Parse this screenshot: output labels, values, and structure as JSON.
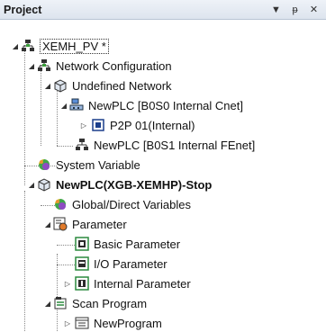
{
  "panel": {
    "title": "Project",
    "controls": {
      "dropdown": "▼",
      "pin": "ᵽ",
      "close": "✕"
    }
  },
  "tree": {
    "root": "XEMH_PV *",
    "network_config": "Network Configuration",
    "undefined_network": "Undefined Network",
    "plc_cnet": "NewPLC [B0S0 Internal Cnet]",
    "p2p": "P2P 01(Internal)",
    "plc_fenet": "NewPLC [B0S1 Internal FEnet]",
    "system_variable": "System Variable",
    "plc_main": "NewPLC(XGB-XEMHP)-Stop",
    "global_vars": "Global/Direct Variables",
    "parameter": "Parameter",
    "basic_param": "Basic Parameter",
    "io_param": "I/O Parameter",
    "internal_param": "Internal Parameter",
    "scan_program": "Scan Program",
    "new_program": "NewProgram"
  },
  "icons": {
    "expanded": "◢",
    "collapsed": "▷"
  }
}
